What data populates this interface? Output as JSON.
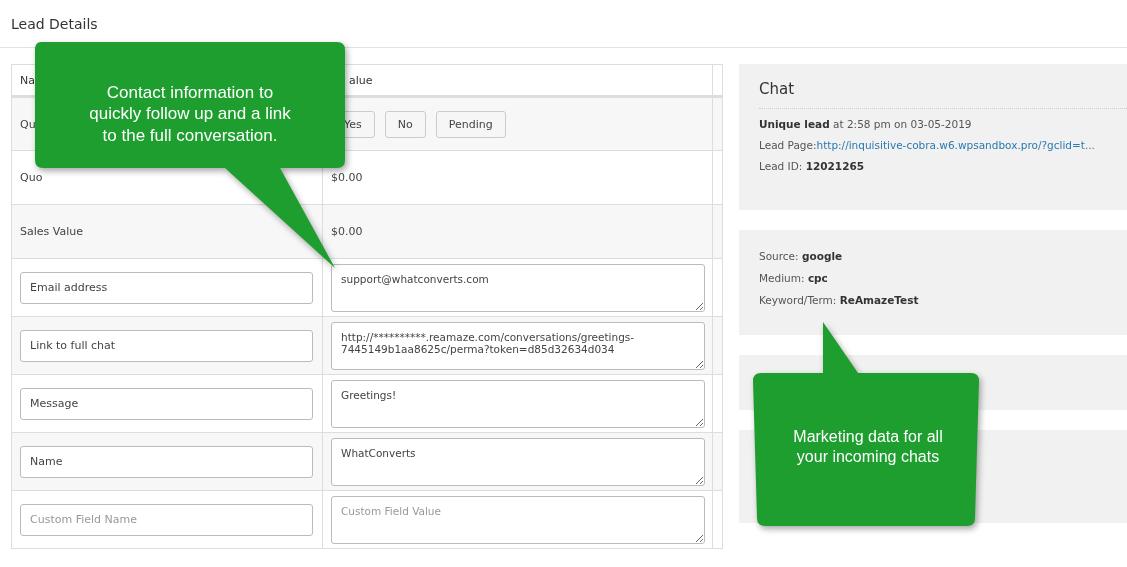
{
  "title": "Lead Details",
  "table": {
    "columns": [
      "Na",
      "alue"
    ],
    "rows": [
      {
        "kind": "buttons",
        "label": "Qu",
        "buttons": [
          "Yes",
          "No",
          "Pending"
        ]
      },
      {
        "kind": "text",
        "label": "Quo",
        "value": "$0.00"
      },
      {
        "kind": "text",
        "label": "Sales Value",
        "value": "$0.00"
      },
      {
        "kind": "fields",
        "name": {
          "value": "Email address"
        },
        "value": {
          "value": "support@whatconverts.com"
        }
      },
      {
        "kind": "fields",
        "name": {
          "value": "Link to full chat"
        },
        "value": {
          "value": "http://**********.reamaze.com/conversations/greetings-7445149b1aa8625c/perma?token=d85d32634d034"
        }
      },
      {
        "kind": "fields",
        "name": {
          "value": "Message"
        },
        "value": {
          "value": "Greetings!"
        }
      },
      {
        "kind": "fields",
        "name": {
          "value": "Name"
        },
        "value": {
          "value": "WhatConverts"
        }
      },
      {
        "kind": "fields",
        "name": {
          "placeholder": "Custom Field Name"
        },
        "value": {
          "placeholder": "Custom Field Value"
        }
      }
    ]
  },
  "chat_panel": {
    "title": "Chat",
    "lines": [
      {
        "kind": "text",
        "text": "**Unique lead** at 2:58 pm on 03-05-2019"
      },
      {
        "kind": "link",
        "label": "Lead Page:",
        "link": "http://inquisitive-cobra.w6.wpsandbox.pro/?gclid=t..."
      },
      {
        "kind": "text",
        "text": "Lead ID: **12021265**"
      }
    ]
  },
  "marketing_panel": {
    "lines": [
      "Source: **google**",
      "Medium: **cpc**",
      "Keyword/Term: **ReAmazeTest**"
    ]
  },
  "callouts": [
    {
      "kind": "down",
      "text": "Contact information to quickly follow up and a link to the full conversation."
    },
    {
      "kind": "up",
      "text": "Marketing data for all your incoming chats"
    }
  ]
}
